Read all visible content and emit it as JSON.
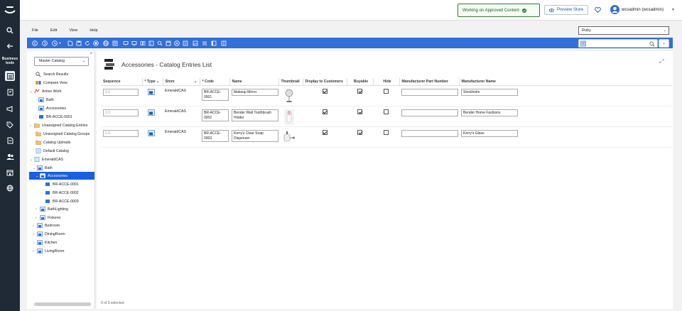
{
  "rail": {
    "business_tools": "Business tools",
    "items": [
      "search-icon",
      "back-icon",
      "catalog-icon",
      "orders-icon",
      "marketing-icon",
      "promotions-icon",
      "contracts-icon",
      "people-icon",
      "store-icon",
      "world-icon"
    ]
  },
  "topbar": {
    "working_label": "Working on Approved Content",
    "preview_label": "Preview Store",
    "user_label": "wcsadmin (wcsadmin)"
  },
  "menu": {
    "items": [
      "File",
      "Edit",
      "View",
      "Help"
    ]
  },
  "store_select": {
    "value": "Ruby"
  },
  "left": {
    "catalog_select": "Master Catalog",
    "search_results": "Search Results",
    "compare_view": "Compare View",
    "active_work": "Active Work",
    "aw_bath": "Bath",
    "aw_accessories": "Accessories",
    "aw_br1": "BR-ACCE-0001",
    "unassigned_entries": "Unassigned Catalog Entries",
    "unassigned_groups": "Unassigned Catalog Groups",
    "catalog_uploads": "Catalog Uploads",
    "default_catalog": "Default Catalog",
    "emerald": "EmeraldCAS",
    "bath": "Bath",
    "accessories": "Accessories",
    "br1": "BR-ACCE-0001",
    "br2": "BR-ACCE-0002",
    "br3": "BR-ACCE-0003",
    "bathlighting": "BathLighting",
    "fixtures": "Fixtures",
    "bedroom": "Bedroom",
    "diningroom": "DiningRoom",
    "kitchen": "Kitchen",
    "livingroom": "LivingRoom"
  },
  "main": {
    "title": "Accessories - Catalog Entries List",
    "columns": {
      "sequence": "Sequence",
      "type": "* Type",
      "store": "Store",
      "code": "* Code",
      "name": "Name",
      "thumbnail": "Thumbnail",
      "display": "Display to Customers",
      "buyable": "Buyable",
      "hide": "Hide",
      "mpn": "Manufacturer Part Number",
      "mname": "Manufacturer Name"
    },
    "rows": [
      {
        "sequence": "1.0",
        "store": "EmeraldCAS",
        "code": "BR-ACCE-0001",
        "name": "Makeup Mirror",
        "mname": "Stockholm"
      },
      {
        "sequence": "1.0",
        "store": "EmeraldCAS",
        "code": "BR-ACCE-0002",
        "name": "Bender Wall Toothbrush Holder",
        "mname": "Bender Home Fashions"
      },
      {
        "sequence": "1.0",
        "store": "EmeraldCAS",
        "code": "BR-ACCE-0003",
        "name": "Kerry's Clear Soap Dispenser",
        "mname": "Kerry's Glass"
      }
    ],
    "status": "0 of 3 selected"
  },
  "colors": {
    "rail": "#1f2a36",
    "toolbar": "#2f6fde",
    "selection": "#1660e8"
  }
}
